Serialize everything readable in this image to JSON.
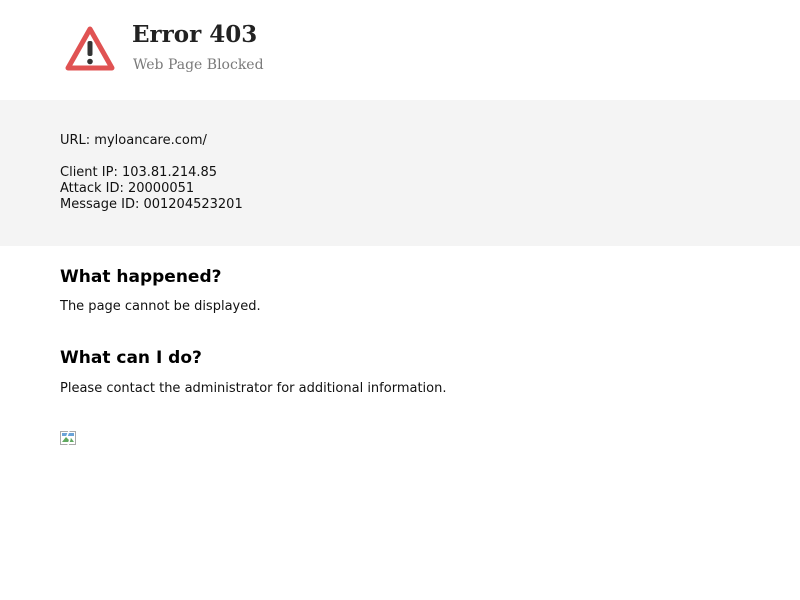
{
  "header": {
    "title": "Error 403",
    "subtitle": "Web Page Blocked",
    "icon": "warning-triangle-icon",
    "icon_color": "#e05252"
  },
  "info": {
    "url": "URL: myloancare.com/",
    "client_ip": "Client IP: 103.81.214.85",
    "attack_id": "Attack ID: 20000051",
    "message_id": "Message ID: 001204523201"
  },
  "sections": [
    {
      "heading": "What happened?",
      "text": "The page cannot be displayed."
    },
    {
      "heading": "What can I do?",
      "text": "Please contact the administrator for additional information."
    }
  ],
  "footer_image": {
    "icon": "broken-image-icon"
  },
  "colors": {
    "panel_background": "#f4f4f4",
    "warning": "#e05252"
  }
}
